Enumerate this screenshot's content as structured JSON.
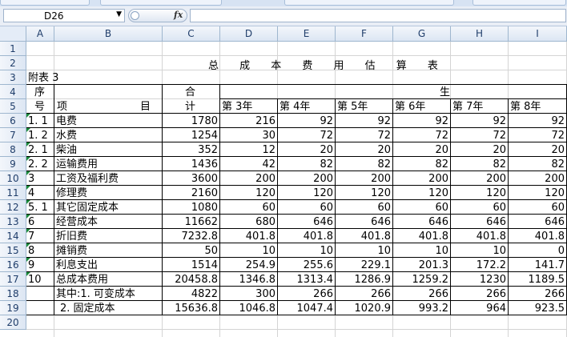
{
  "formula_bar": {
    "name_box": "D26",
    "fx_label": "fx",
    "formula": ""
  },
  "columns": [
    "A",
    "B",
    "C",
    "D",
    "E",
    "F",
    "G",
    "H",
    "I"
  ],
  "rows": [
    "1",
    "2",
    "3",
    "4",
    "5",
    "6",
    "7",
    "8",
    "9",
    "10",
    "11",
    "12",
    "13",
    "14",
    "15",
    "16",
    "17",
    "18",
    "19",
    "20"
  ],
  "sheet": {
    "title": "总 成 本 费 用 估 算 表",
    "note": "附表 3",
    "hdr_seq_1": "序",
    "hdr_seq_2": "号",
    "hdr_item_1": "项",
    "hdr_item_2": "目",
    "hdr_total_1": "合",
    "hdr_total_2": "计",
    "hdr_group": "生",
    "years": [
      "第 3年",
      "第 4年",
      "第 5年",
      "第 6年",
      "第 7年",
      "第 8年"
    ]
  },
  "table_rows": [
    {
      "seq": "1. 1",
      "item": "电费",
      "values": [
        "1780",
        "216",
        "92",
        "92",
        "92",
        "92",
        "92"
      ]
    },
    {
      "seq": "1. 2",
      "item": "水费",
      "values": [
        "1254",
        "30",
        "72",
        "72",
        "72",
        "72",
        "72"
      ]
    },
    {
      "seq": "2. 1",
      "item": "柴油",
      "values": [
        "352",
        "12",
        "20",
        "20",
        "20",
        "20",
        "20"
      ]
    },
    {
      "seq": "2. 2",
      "item": "运输费用",
      "values": [
        "1436",
        "42",
        "82",
        "82",
        "82",
        "82",
        "82"
      ]
    },
    {
      "seq": "3",
      "item": "工资及福利费",
      "values": [
        "3600",
        "200",
        "200",
        "200",
        "200",
        "200",
        "200"
      ]
    },
    {
      "seq": "4",
      "item": "修理费",
      "values": [
        "2160",
        "120",
        "120",
        "120",
        "120",
        "120",
        "120"
      ]
    },
    {
      "seq": "5. 1",
      "item": "其它固定成本",
      "values": [
        "1080",
        "60",
        "60",
        "60",
        "60",
        "60",
        "60"
      ]
    },
    {
      "seq": "6",
      "item": "经营成本",
      "values": [
        "11662",
        "680",
        "646",
        "646",
        "646",
        "646",
        "646"
      ]
    },
    {
      "seq": "7",
      "item": "折旧费",
      "values": [
        "7232.8",
        "401.8",
        "401.8",
        "401.8",
        "401.8",
        "401.8",
        "401.8"
      ]
    },
    {
      "seq": "8",
      "item": "摊销费",
      "values": [
        "50",
        "10",
        "10",
        "10",
        "10",
        "10",
        "0"
      ]
    },
    {
      "seq": "9",
      "item": "利息支出",
      "values": [
        "1514",
        "254.9",
        "255.6",
        "229.1",
        "201.3",
        "172.2",
        "141.7"
      ]
    },
    {
      "seq": "10",
      "item": "总成本费用",
      "values": [
        "20458.8",
        "1346.8",
        "1313.4",
        "1286.9",
        "1259.2",
        "1230",
        "1189.5"
      ]
    },
    {
      "seq": "",
      "item": "其中:1. 可变成本",
      "values": [
        "4822",
        "300",
        "266",
        "266",
        "266",
        "266",
        "266"
      ]
    },
    {
      "seq": "",
      "item": "2. 固定成本",
      "values": [
        "15636.8",
        "1046.8",
        "1047.4",
        "1020.9",
        "993.2",
        "964",
        "923.5"
      ]
    }
  ],
  "colors": {
    "grid": "#d4d4d4",
    "header_bg": "#dce6f3",
    "header_text": "#1f3d6a",
    "error_marker": "#1a8a3a"
  }
}
